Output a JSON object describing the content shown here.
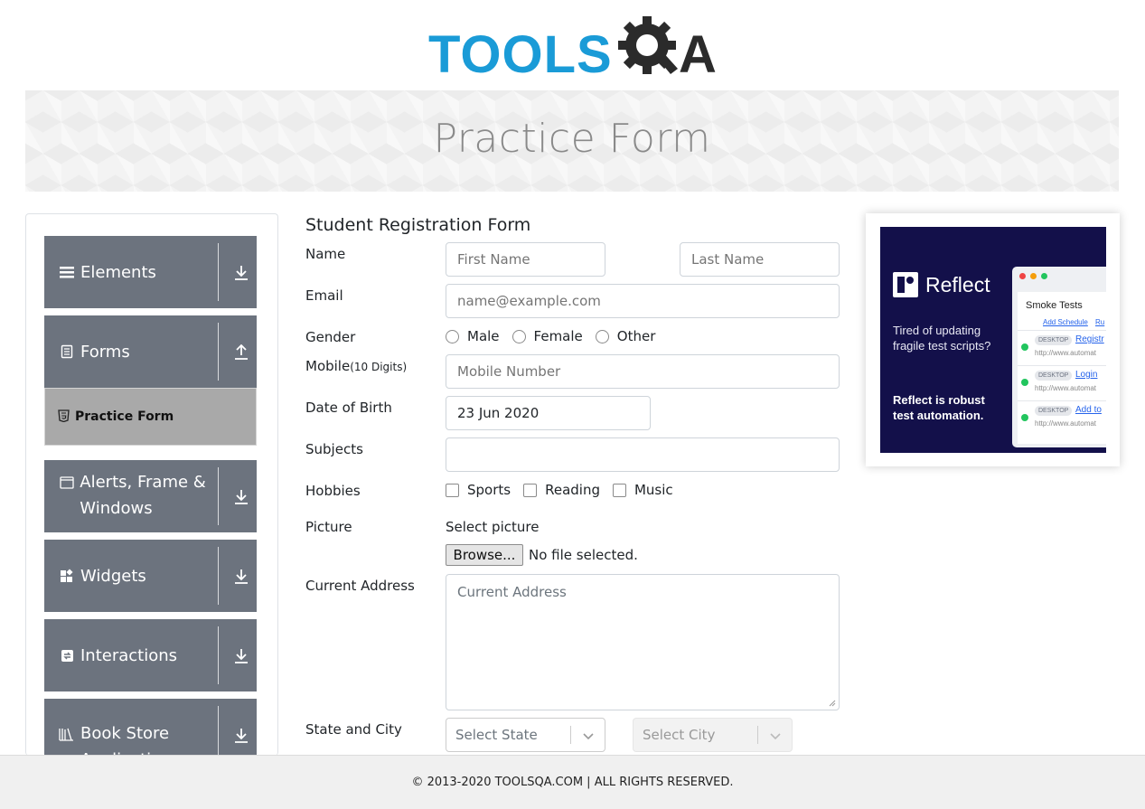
{
  "logo": {
    "text": "TOOLS",
    "text_end": "A",
    "alt": "TOOLSQA"
  },
  "banner": {
    "title": "Practice Form"
  },
  "sidebar": {
    "groups": [
      {
        "label": "Elements",
        "icon": "menu-icon",
        "toggle": "download-icon"
      },
      {
        "label": "Forms",
        "icon": "document-icon",
        "toggle": "upload-icon"
      },
      {
        "label": "Alerts, Frame & Windows",
        "icon": "window-icon",
        "toggle": "download-icon"
      },
      {
        "label": "Widgets",
        "icon": "widgets-icon",
        "toggle": "download-icon"
      },
      {
        "label": "Interactions",
        "icon": "sync-icon",
        "toggle": "download-icon"
      },
      {
        "label": "Book Store Application",
        "icon": "books-icon",
        "toggle": "download-icon"
      }
    ],
    "active_item": {
      "label": "Practice Form",
      "icon": "html5-icon"
    }
  },
  "form": {
    "title": "Student Registration Form",
    "name": {
      "label": "Name",
      "first_placeholder": "First Name",
      "last_placeholder": "Last Name"
    },
    "email": {
      "label": "Email",
      "placeholder": "name@example.com"
    },
    "gender": {
      "label": "Gender",
      "options": [
        "Male",
        "Female",
        "Other"
      ]
    },
    "mobile": {
      "label": "Mobile",
      "label_hint": "(10 Digits)",
      "placeholder": "Mobile Number"
    },
    "dob": {
      "label": "Date of Birth",
      "value": "23 Jun 2020"
    },
    "subjects": {
      "label": "Subjects",
      "value": ""
    },
    "hobbies": {
      "label": "Hobbies",
      "options": [
        "Sports",
        "Reading",
        "Music"
      ]
    },
    "picture": {
      "label": "Picture",
      "select_label": "Select picture",
      "browse_label": "Browse...",
      "file_status": "No file selected."
    },
    "address": {
      "label": "Current Address",
      "placeholder": "Current Address"
    },
    "state_city": {
      "label": "State and City",
      "state_placeholder": "Select State",
      "city_placeholder": "Select City"
    }
  },
  "ad": {
    "brand": "Reflect",
    "tagline": "Tired of updating fragile test scripts?",
    "strong": "Reflect is robust test automation.",
    "panel_title": "Smoke Tests",
    "panel_link": "Add Schedule",
    "panel_link_2": "Ru",
    "rows": [
      {
        "badge": "DESKTOP",
        "link": "Registr",
        "url": "http://www.automat"
      },
      {
        "badge": "DESKTOP",
        "link": "Login",
        "url": "http://www.automat"
      },
      {
        "badge": "DESKTOP",
        "link": "Add to",
        "url": "http://www.automat"
      }
    ]
  },
  "footer": {
    "text": "© 2013-2020 TOOLSQA.COM | ALL RIGHTS RESERVED."
  },
  "colors": {
    "brand_blue": "#1a9bd7",
    "sidebar_bg": "#6c737e",
    "active_item_bg": "#a9a9a9",
    "ad_bg": "#13104a"
  }
}
